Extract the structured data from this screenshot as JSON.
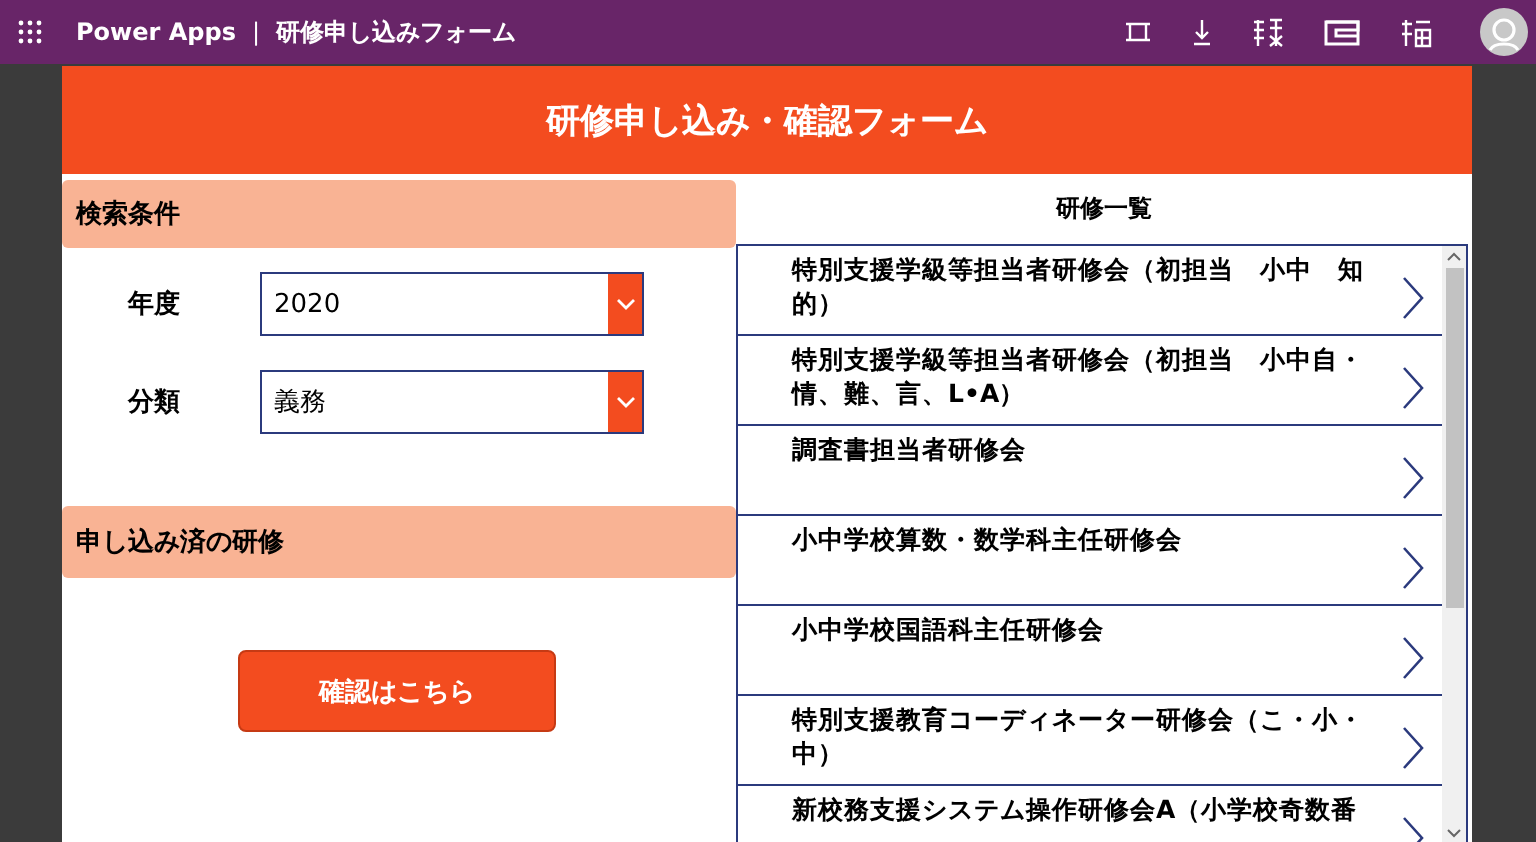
{
  "top_bar": {
    "brand": "Power Apps",
    "separator": "|",
    "title": "研修申し込みフォーム"
  },
  "form": {
    "title": "研修申し込み・確認フォーム",
    "search_section": {
      "title": "検索条件",
      "fields": [
        {
          "label": "年度",
          "value": "2020"
        },
        {
          "label": "分類",
          "value": "義務"
        }
      ]
    },
    "applied_section": {
      "title": "申し込み済の研修"
    },
    "confirm_button": "確認はこちら",
    "training_list": {
      "title": "研修一覧",
      "items": [
        {
          "text": "特別支援学級等担当者研修会（初担当　小中　知的）"
        },
        {
          "text": "特別支援学級等担当者研修会（初担当　小中自・情、難、言、L•A）"
        },
        {
          "text": "調査書担当者研修会"
        },
        {
          "text": "小中学校算数・数学科主任研修会"
        },
        {
          "text": "小中学校国語科主任研修会"
        },
        {
          "text": "特別支援教育コーディネーター研修会（こ・小・中）"
        },
        {
          "text": "新校務支援システム操作研修会A（小学校奇数番"
        }
      ]
    }
  }
}
